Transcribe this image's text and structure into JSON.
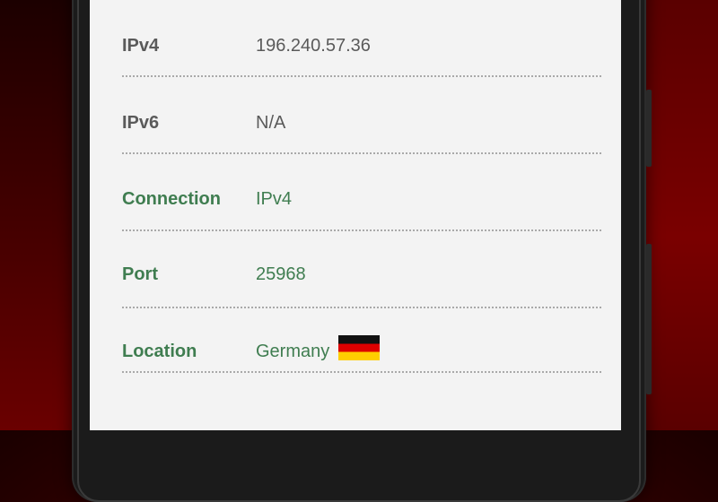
{
  "info_rows": [
    {
      "label": "IPv4",
      "value": "196.240.57.36",
      "style": "neutral"
    },
    {
      "label": "IPv6",
      "value": "N/A",
      "style": "neutral"
    },
    {
      "label": "Connection",
      "value": "IPv4",
      "style": "positive"
    },
    {
      "label": "Port",
      "value": "25968",
      "style": "positive"
    },
    {
      "label": "Location",
      "value": "Germany",
      "style": "positive",
      "flag_icon": "germany-flag-icon"
    }
  ],
  "colors": {
    "neutral_text": "#5a5a5a",
    "positive_text": "#3f7d50",
    "screen_bg": "#f3f3f3",
    "backdrop": "#5a0000"
  }
}
